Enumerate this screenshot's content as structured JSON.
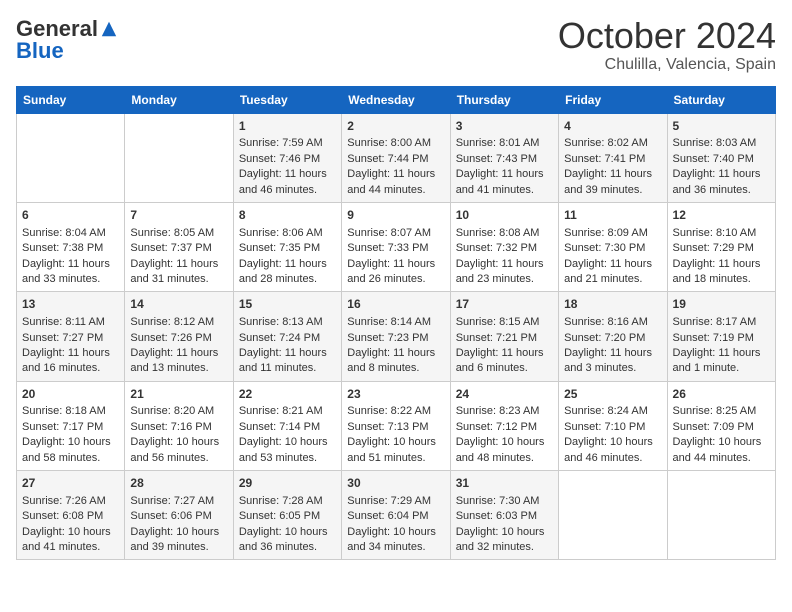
{
  "logo": {
    "general": "General",
    "blue": "Blue"
  },
  "title": "October 2024",
  "subtitle": "Chulilla, Valencia, Spain",
  "weekdays": [
    "Sunday",
    "Monday",
    "Tuesday",
    "Wednesday",
    "Thursday",
    "Friday",
    "Saturday"
  ],
  "weeks": [
    [
      {
        "day": "",
        "sunrise": "",
        "sunset": "",
        "daylight": ""
      },
      {
        "day": "",
        "sunrise": "",
        "sunset": "",
        "daylight": ""
      },
      {
        "day": "1",
        "sunrise": "Sunrise: 7:59 AM",
        "sunset": "Sunset: 7:46 PM",
        "daylight": "Daylight: 11 hours and 46 minutes."
      },
      {
        "day": "2",
        "sunrise": "Sunrise: 8:00 AM",
        "sunset": "Sunset: 7:44 PM",
        "daylight": "Daylight: 11 hours and 44 minutes."
      },
      {
        "day": "3",
        "sunrise": "Sunrise: 8:01 AM",
        "sunset": "Sunset: 7:43 PM",
        "daylight": "Daylight: 11 hours and 41 minutes."
      },
      {
        "day": "4",
        "sunrise": "Sunrise: 8:02 AM",
        "sunset": "Sunset: 7:41 PM",
        "daylight": "Daylight: 11 hours and 39 minutes."
      },
      {
        "day": "5",
        "sunrise": "Sunrise: 8:03 AM",
        "sunset": "Sunset: 7:40 PM",
        "daylight": "Daylight: 11 hours and 36 minutes."
      }
    ],
    [
      {
        "day": "6",
        "sunrise": "Sunrise: 8:04 AM",
        "sunset": "Sunset: 7:38 PM",
        "daylight": "Daylight: 11 hours and 33 minutes."
      },
      {
        "day": "7",
        "sunrise": "Sunrise: 8:05 AM",
        "sunset": "Sunset: 7:37 PM",
        "daylight": "Daylight: 11 hours and 31 minutes."
      },
      {
        "day": "8",
        "sunrise": "Sunrise: 8:06 AM",
        "sunset": "Sunset: 7:35 PM",
        "daylight": "Daylight: 11 hours and 28 minutes."
      },
      {
        "day": "9",
        "sunrise": "Sunrise: 8:07 AM",
        "sunset": "Sunset: 7:33 PM",
        "daylight": "Daylight: 11 hours and 26 minutes."
      },
      {
        "day": "10",
        "sunrise": "Sunrise: 8:08 AM",
        "sunset": "Sunset: 7:32 PM",
        "daylight": "Daylight: 11 hours and 23 minutes."
      },
      {
        "day": "11",
        "sunrise": "Sunrise: 8:09 AM",
        "sunset": "Sunset: 7:30 PM",
        "daylight": "Daylight: 11 hours and 21 minutes."
      },
      {
        "day": "12",
        "sunrise": "Sunrise: 8:10 AM",
        "sunset": "Sunset: 7:29 PM",
        "daylight": "Daylight: 11 hours and 18 minutes."
      }
    ],
    [
      {
        "day": "13",
        "sunrise": "Sunrise: 8:11 AM",
        "sunset": "Sunset: 7:27 PM",
        "daylight": "Daylight: 11 hours and 16 minutes."
      },
      {
        "day": "14",
        "sunrise": "Sunrise: 8:12 AM",
        "sunset": "Sunset: 7:26 PM",
        "daylight": "Daylight: 11 hours and 13 minutes."
      },
      {
        "day": "15",
        "sunrise": "Sunrise: 8:13 AM",
        "sunset": "Sunset: 7:24 PM",
        "daylight": "Daylight: 11 hours and 11 minutes."
      },
      {
        "day": "16",
        "sunrise": "Sunrise: 8:14 AM",
        "sunset": "Sunset: 7:23 PM",
        "daylight": "Daylight: 11 hours and 8 minutes."
      },
      {
        "day": "17",
        "sunrise": "Sunrise: 8:15 AM",
        "sunset": "Sunset: 7:21 PM",
        "daylight": "Daylight: 11 hours and 6 minutes."
      },
      {
        "day": "18",
        "sunrise": "Sunrise: 8:16 AM",
        "sunset": "Sunset: 7:20 PM",
        "daylight": "Daylight: 11 hours and 3 minutes."
      },
      {
        "day": "19",
        "sunrise": "Sunrise: 8:17 AM",
        "sunset": "Sunset: 7:19 PM",
        "daylight": "Daylight: 11 hours and 1 minute."
      }
    ],
    [
      {
        "day": "20",
        "sunrise": "Sunrise: 8:18 AM",
        "sunset": "Sunset: 7:17 PM",
        "daylight": "Daylight: 10 hours and 58 minutes."
      },
      {
        "day": "21",
        "sunrise": "Sunrise: 8:20 AM",
        "sunset": "Sunset: 7:16 PM",
        "daylight": "Daylight: 10 hours and 56 minutes."
      },
      {
        "day": "22",
        "sunrise": "Sunrise: 8:21 AM",
        "sunset": "Sunset: 7:14 PM",
        "daylight": "Daylight: 10 hours and 53 minutes."
      },
      {
        "day": "23",
        "sunrise": "Sunrise: 8:22 AM",
        "sunset": "Sunset: 7:13 PM",
        "daylight": "Daylight: 10 hours and 51 minutes."
      },
      {
        "day": "24",
        "sunrise": "Sunrise: 8:23 AM",
        "sunset": "Sunset: 7:12 PM",
        "daylight": "Daylight: 10 hours and 48 minutes."
      },
      {
        "day": "25",
        "sunrise": "Sunrise: 8:24 AM",
        "sunset": "Sunset: 7:10 PM",
        "daylight": "Daylight: 10 hours and 46 minutes."
      },
      {
        "day": "26",
        "sunrise": "Sunrise: 8:25 AM",
        "sunset": "Sunset: 7:09 PM",
        "daylight": "Daylight: 10 hours and 44 minutes."
      }
    ],
    [
      {
        "day": "27",
        "sunrise": "Sunrise: 7:26 AM",
        "sunset": "Sunset: 6:08 PM",
        "daylight": "Daylight: 10 hours and 41 minutes."
      },
      {
        "day": "28",
        "sunrise": "Sunrise: 7:27 AM",
        "sunset": "Sunset: 6:06 PM",
        "daylight": "Daylight: 10 hours and 39 minutes."
      },
      {
        "day": "29",
        "sunrise": "Sunrise: 7:28 AM",
        "sunset": "Sunset: 6:05 PM",
        "daylight": "Daylight: 10 hours and 36 minutes."
      },
      {
        "day": "30",
        "sunrise": "Sunrise: 7:29 AM",
        "sunset": "Sunset: 6:04 PM",
        "daylight": "Daylight: 10 hours and 34 minutes."
      },
      {
        "day": "31",
        "sunrise": "Sunrise: 7:30 AM",
        "sunset": "Sunset: 6:03 PM",
        "daylight": "Daylight: 10 hours and 32 minutes."
      },
      {
        "day": "",
        "sunrise": "",
        "sunset": "",
        "daylight": ""
      },
      {
        "day": "",
        "sunrise": "",
        "sunset": "",
        "daylight": ""
      }
    ]
  ]
}
